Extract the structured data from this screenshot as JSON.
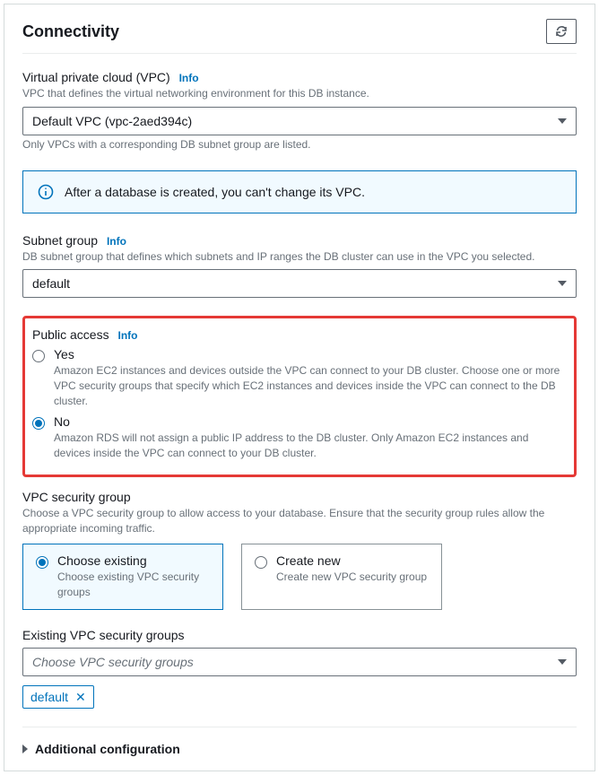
{
  "header": {
    "title": "Connectivity"
  },
  "vpc": {
    "label": "Virtual private cloud (VPC)",
    "info": "Info",
    "helper": "VPC that defines the virtual networking environment for this DB instance.",
    "value": "Default VPC (vpc-2aed394c)",
    "footnote": "Only VPCs with a corresponding DB subnet group are listed."
  },
  "notice": {
    "text": "After a database is created, you can't change its VPC."
  },
  "subnet": {
    "label": "Subnet group",
    "info": "Info",
    "helper": "DB subnet group that defines which subnets and IP ranges the DB cluster can use in the VPC you selected.",
    "value": "default"
  },
  "public_access": {
    "label": "Public access",
    "info": "Info",
    "options": [
      {
        "value": "Yes",
        "desc": "Amazon EC2 instances and devices outside the VPC can connect to your DB cluster. Choose one or more VPC security groups that specify which EC2 instances and devices inside the VPC can connect to the DB cluster.",
        "selected": false
      },
      {
        "value": "No",
        "desc": "Amazon RDS will not assign a public IP address to the DB cluster. Only Amazon EC2 instances and devices inside the VPC can connect to your DB cluster.",
        "selected": true
      }
    ]
  },
  "security_group": {
    "label": "VPC security group",
    "helper": "Choose a VPC security group to allow access to your database. Ensure that the security group rules allow the appropriate incoming traffic.",
    "options": [
      {
        "value": "Choose existing",
        "desc": "Choose existing VPC security groups",
        "selected": true
      },
      {
        "value": "Create new",
        "desc": "Create new VPC security group",
        "selected": false
      }
    ]
  },
  "existing_sg": {
    "label": "Existing VPC security groups",
    "placeholder": "Choose VPC security groups",
    "tokens": [
      "default"
    ]
  },
  "additional": {
    "label": "Additional configuration"
  }
}
